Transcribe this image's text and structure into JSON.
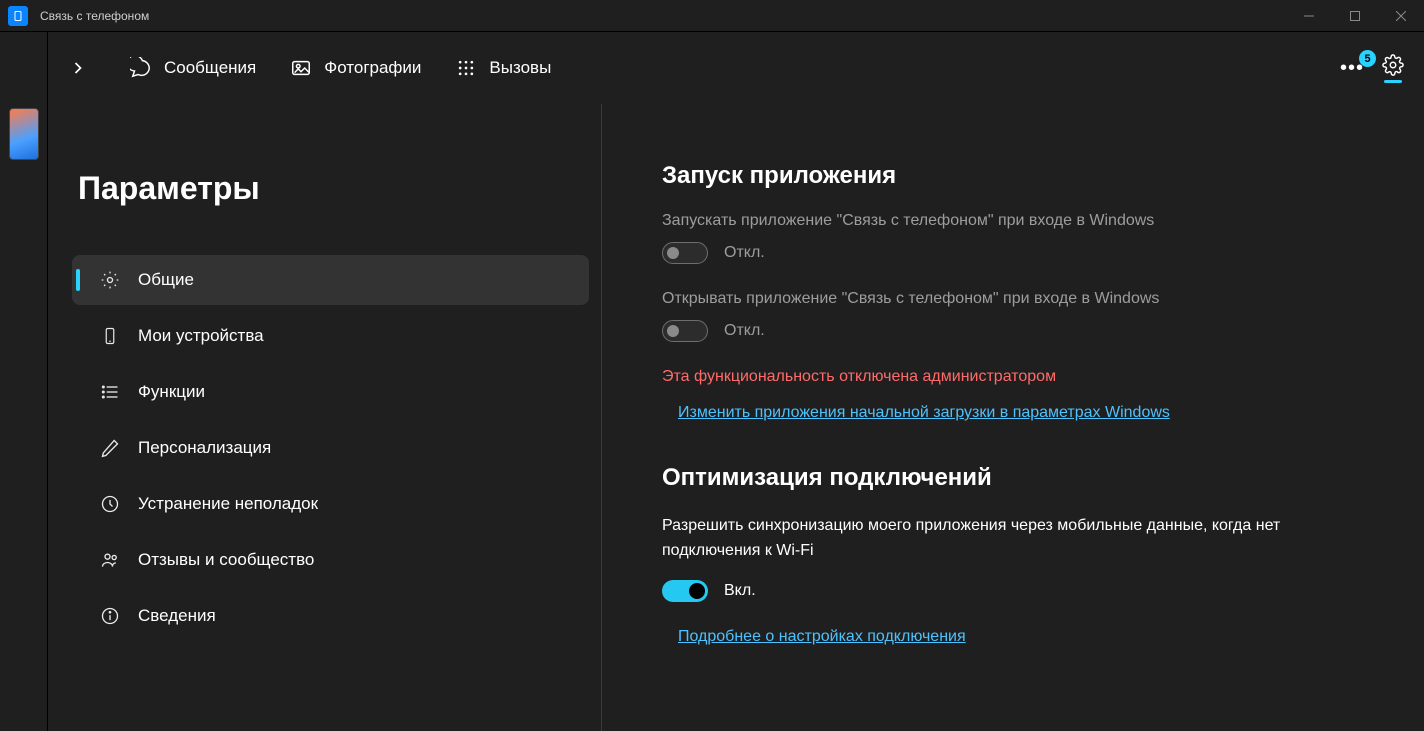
{
  "titlebar": {
    "title": "Связь с телефоном"
  },
  "tabs": {
    "messages": "Сообщения",
    "photos": "Фотографии",
    "calls": "Вызовы",
    "badge": "5"
  },
  "sidebar": {
    "title": "Параметры",
    "items": [
      {
        "label": "Общие"
      },
      {
        "label": "Мои устройства"
      },
      {
        "label": "Функции"
      },
      {
        "label": "Персонализация"
      },
      {
        "label": "Устранение неполадок"
      },
      {
        "label": "Отзывы и сообщество"
      },
      {
        "label": "Сведения"
      }
    ]
  },
  "pane": {
    "section1_title": "Запуск приложения",
    "launch_desc": "Запускать приложение \"Связь с телефоном\" при входе в Windows",
    "launch_toggle_label": "Откл.",
    "open_desc": "Открывать приложение \"Связь с телефоном\" при входе в Windows",
    "open_toggle_label": "Откл.",
    "admin_warning": "Эта функциональность отключена администратором",
    "startup_link": "Изменить приложения начальной загрузки в параметрах Windows",
    "section2_title": "Оптимизация подключений",
    "sync_desc": "Разрешить синхронизацию моего приложения через мобильные данные, когда нет подключения к Wi-Fi",
    "sync_toggle_label": "Вкл.",
    "conn_link": "Подробнее о настройках подключения"
  }
}
